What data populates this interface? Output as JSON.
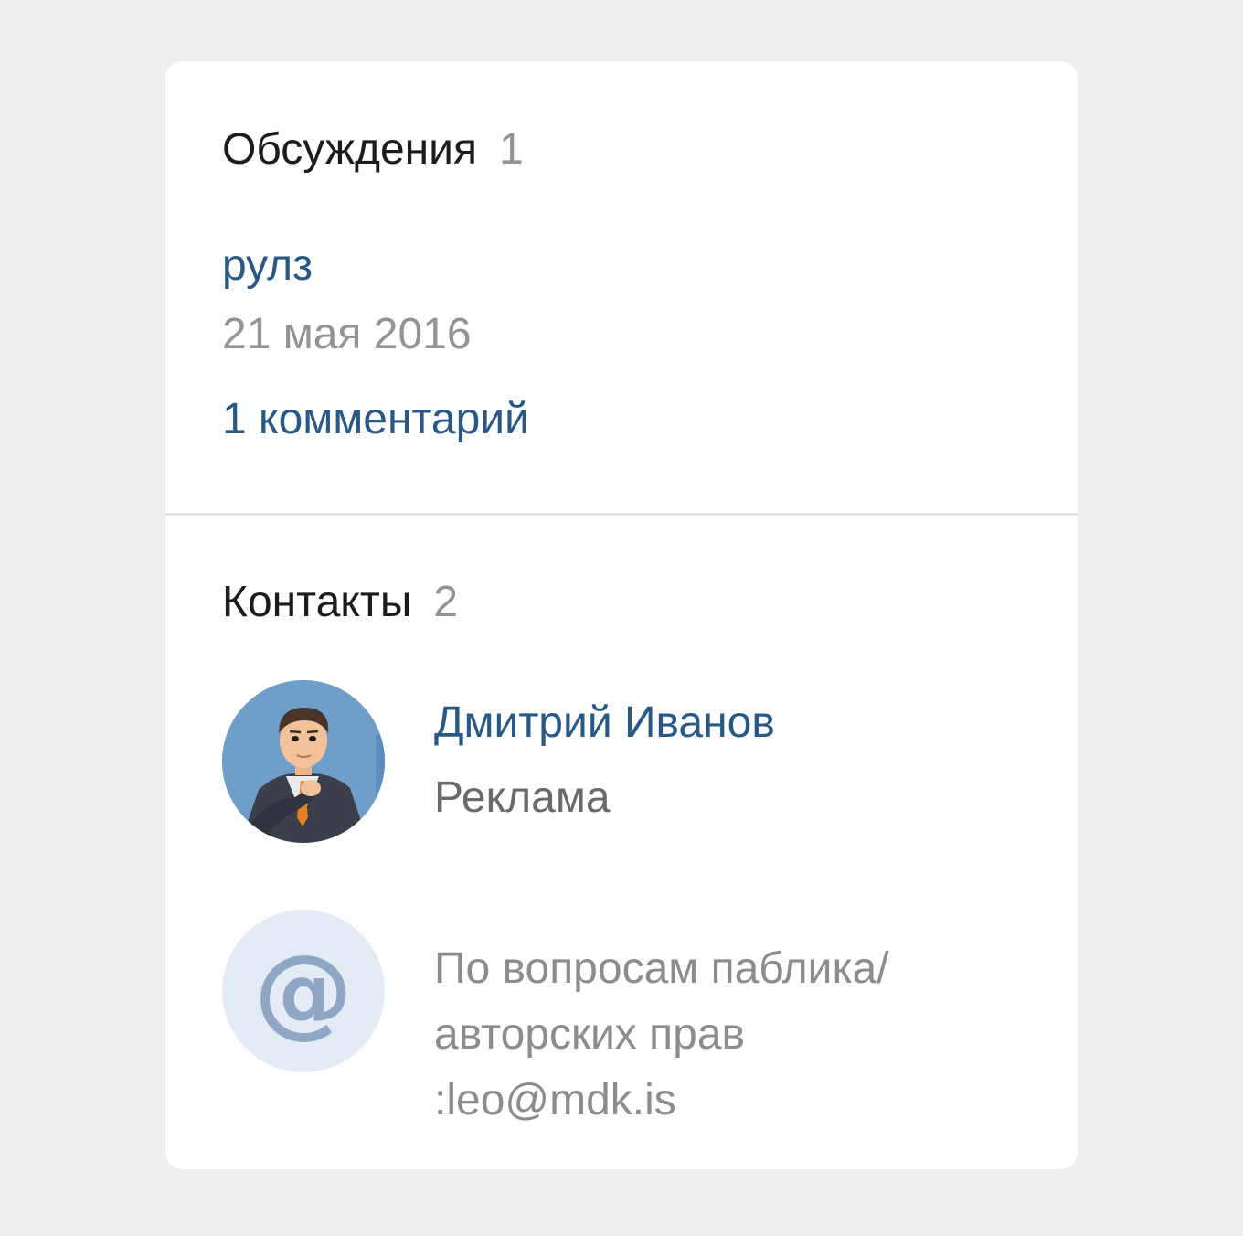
{
  "discussions": {
    "title": "Обсуждения",
    "count": "1",
    "topic": {
      "title": "рулз",
      "date": "21 мая 2016",
      "comments": "1 комментарий"
    }
  },
  "contacts": {
    "title": "Контакты",
    "count": "2",
    "items": [
      {
        "name": "Дмитрий Иванов",
        "description": "Реклама",
        "avatar_icon": "cartoon-businessman-avatar"
      },
      {
        "avatar_symbol": "@",
        "avatar_icon": "at-sign-icon",
        "lines": [
          "По вопросам паблика/",
          "авторских прав",
          ":leo@mdk.is"
        ]
      }
    ]
  },
  "colors": {
    "background": "#edeef0",
    "link": "#2a5885",
    "count": "#909499",
    "muted": "#939393"
  }
}
